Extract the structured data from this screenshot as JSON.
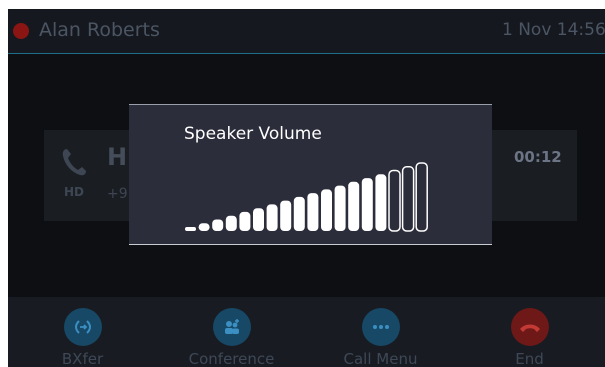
{
  "status": {
    "caller": "Alan Roberts",
    "datetime": "1 Nov 14:56"
  },
  "call": {
    "name": "Hi",
    "number": "+9",
    "hd": "HD",
    "timer": "00:12"
  },
  "softkeys": [
    {
      "label": "BXfer",
      "icon": "transfer-icon"
    },
    {
      "label": "Conference",
      "icon": "conference-icon"
    },
    {
      "label": "Call Menu",
      "icon": "more-icon"
    },
    {
      "label": "End",
      "icon": "hangup-icon"
    }
  ],
  "volume": {
    "title": "Speaker Volume",
    "level": 15,
    "max": 18
  },
  "colors": {
    "accent": "#1e6f8a",
    "end": "#6e1818",
    "popup": "#2b2d3a"
  }
}
